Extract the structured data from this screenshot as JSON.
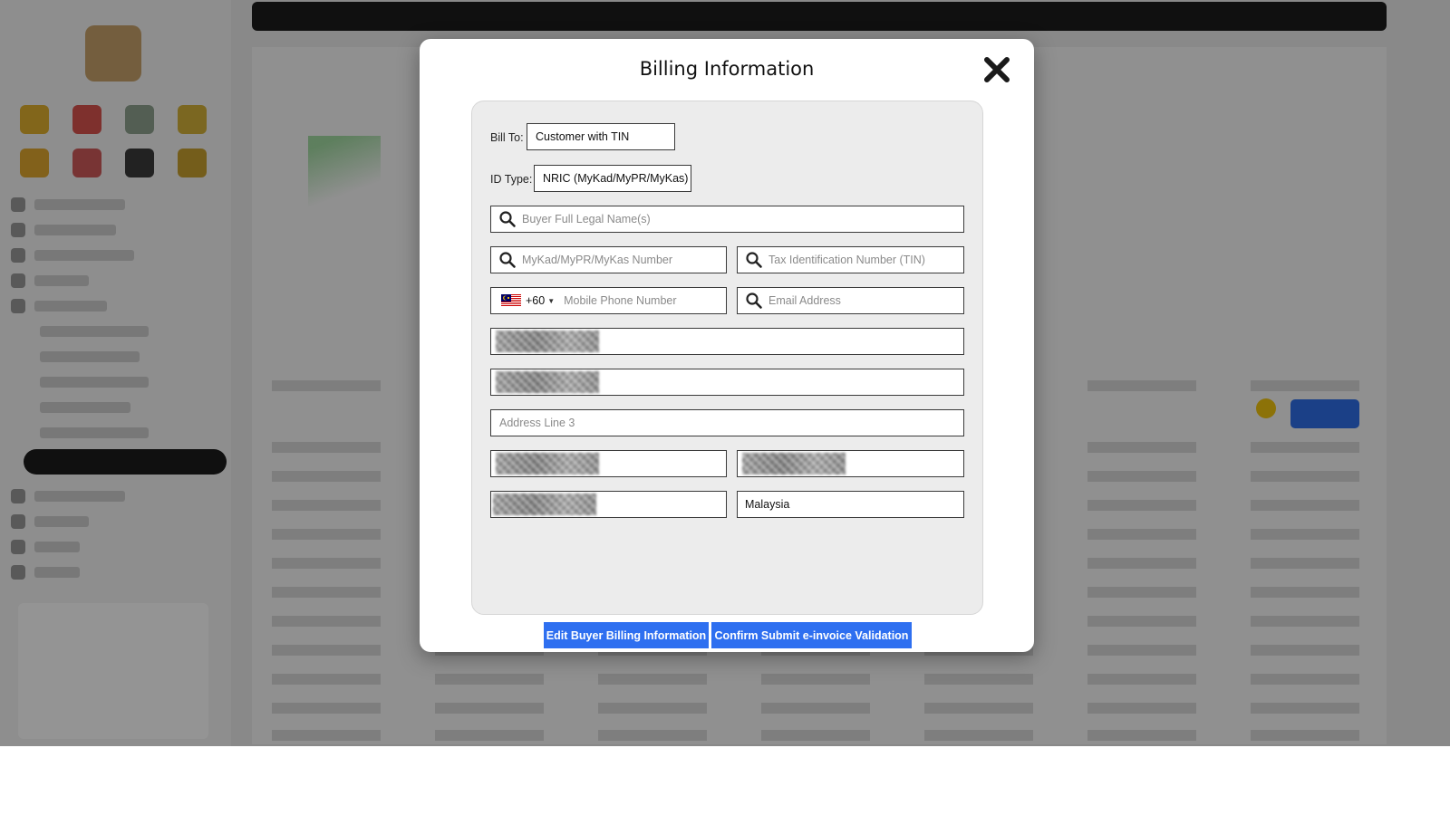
{
  "modal": {
    "title": "Billing Information"
  },
  "form": {
    "bill_to": {
      "label": "Bill To:",
      "value": "Customer with TIN"
    },
    "id_type": {
      "label": "ID Type:",
      "value": "NRIC (MyKad/MyPR/MyKas)"
    },
    "buyer_name": {
      "placeholder": "Buyer Full Legal Name(s)",
      "icon": "search-icon"
    },
    "id_number": {
      "placeholder": "MyKad/MyPR/MyKas Number",
      "icon": "search-icon"
    },
    "tin": {
      "placeholder": "Tax Identification Number (TIN)",
      "icon": "search-icon"
    },
    "phone": {
      "country_flag": "malaysia-flag-icon",
      "dial_code": "+60",
      "placeholder": "Mobile Phone Number"
    },
    "email": {
      "placeholder": "Email Address",
      "icon": "search-icon"
    },
    "address_line_3": {
      "placeholder": "Address Line 3"
    },
    "country": {
      "value": "Malaysia"
    }
  },
  "buttons": {
    "edit": "Edit Buyer Billing Information",
    "confirm": "Confirm Submit e-invoice Validation"
  },
  "colors": {
    "primary_button": "#2e6ff0",
    "overlay": "rgba(0,0,0,0.42)"
  }
}
